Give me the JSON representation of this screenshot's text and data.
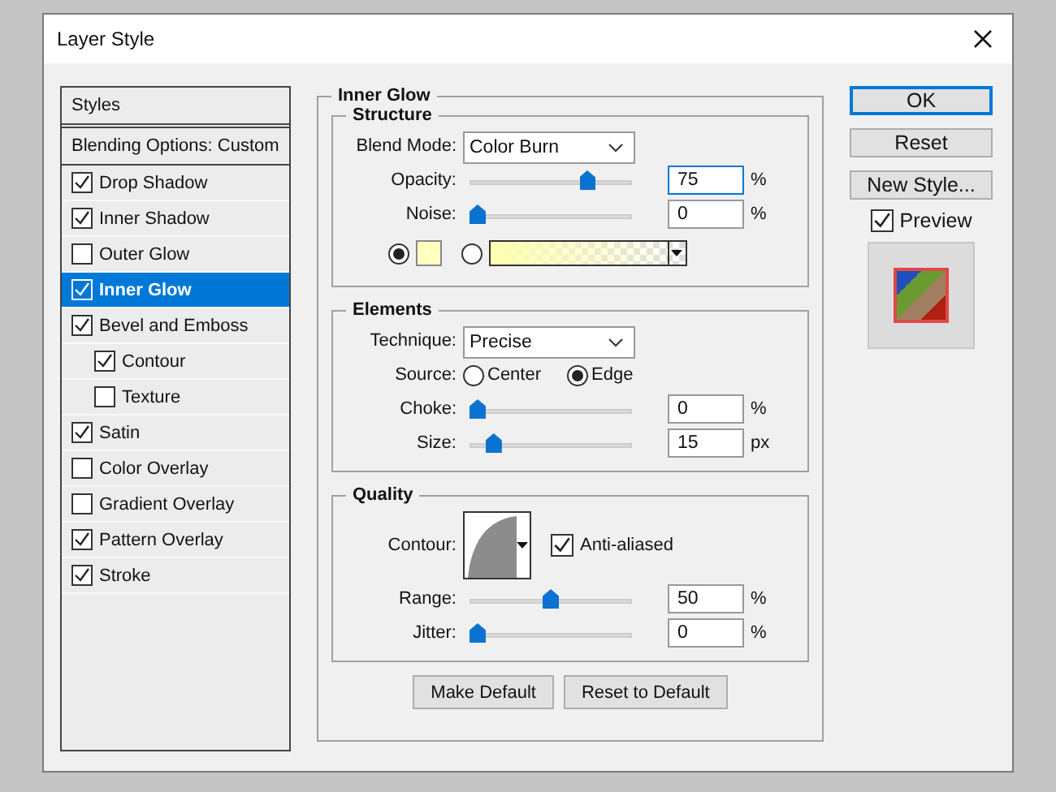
{
  "window": {
    "title": "Layer Style"
  },
  "sidebar": {
    "items": [
      {
        "kind": "header",
        "label": "Styles",
        "selected": false
      },
      {
        "kind": "header",
        "label": "Blending Options: Custom",
        "selected": false
      },
      {
        "kind": "effect",
        "label": "Drop Shadow",
        "checked": true,
        "selected": false
      },
      {
        "kind": "effect",
        "label": "Inner Shadow",
        "checked": true,
        "selected": false
      },
      {
        "kind": "effect",
        "label": "Outer Glow",
        "checked": false,
        "selected": false
      },
      {
        "kind": "effect",
        "label": "Inner Glow",
        "checked": true,
        "selected": true
      },
      {
        "kind": "effect",
        "label": "Bevel and Emboss",
        "checked": true,
        "selected": false,
        "children": [
          {
            "kind": "effect",
            "label": "Contour",
            "checked": true,
            "selected": false
          },
          {
            "kind": "effect",
            "label": "Texture",
            "checked": false,
            "selected": false
          }
        ]
      },
      {
        "kind": "effect",
        "label": "Satin",
        "checked": true,
        "selected": false
      },
      {
        "kind": "effect",
        "label": "Color Overlay",
        "checked": false,
        "selected": false
      },
      {
        "kind": "effect",
        "label": "Gradient Overlay",
        "checked": false,
        "selected": false
      },
      {
        "kind": "effect",
        "label": "Pattern Overlay",
        "checked": true,
        "selected": false
      },
      {
        "kind": "effect",
        "label": "Stroke",
        "checked": true,
        "selected": false
      }
    ]
  },
  "panel": {
    "title": "Inner Glow",
    "groups": [
      {
        "title": "Structure",
        "rows": [
          {
            "kind": "select",
            "label": "Blend Mode:",
            "value": "Color Burn"
          },
          {
            "kind": "slider",
            "label": "Opacity:",
            "level": 0.75,
            "value": "75",
            "unit": "%",
            "focused": true
          },
          {
            "kind": "slider",
            "label": "Noise:",
            "level": 0,
            "value": "0",
            "unit": "%",
            "focused": false
          },
          {
            "kind": "fill",
            "options": [
              {
                "kind": "color",
                "selected": true
              },
              {
                "kind": "gradient",
                "selected": false
              }
            ]
          }
        ]
      },
      {
        "title": "Elements",
        "rows": [
          {
            "kind": "select",
            "label": "Technique:",
            "value": "Precise"
          },
          {
            "kind": "radio",
            "label": "Source:",
            "options": [
              {
                "label": "Center",
                "selected": false
              },
              {
                "label": "Edge",
                "selected": true
              }
            ]
          },
          {
            "kind": "slider",
            "label": "Choke:",
            "level": 0,
            "value": "0",
            "unit": "%",
            "focused": false
          },
          {
            "kind": "slider",
            "label": "Size:",
            "level": 0.11,
            "value": "15",
            "unit": "px",
            "focused": false
          }
        ]
      },
      {
        "title": "Quality",
        "rows": [
          {
            "kind": "contour",
            "label": "Contour:",
            "checkbox": {
              "label": "Anti-aliased",
              "checked": true
            }
          },
          {
            "kind": "slider",
            "label": "Range:",
            "level": 0.5,
            "value": "50",
            "unit": "%",
            "focused": false
          },
          {
            "kind": "slider",
            "label": "Jitter:",
            "level": 0,
            "value": "0",
            "unit": "%",
            "focused": false
          }
        ]
      }
    ],
    "buttons": [
      "Make Default",
      "Reset to Default"
    ]
  },
  "actions": [
    {
      "label": "OK",
      "default": true
    },
    {
      "label": "Reset",
      "default": false
    },
    {
      "label": "New Style...",
      "default": false
    }
  ],
  "preview": {
    "label": "Preview",
    "checked": true
  }
}
